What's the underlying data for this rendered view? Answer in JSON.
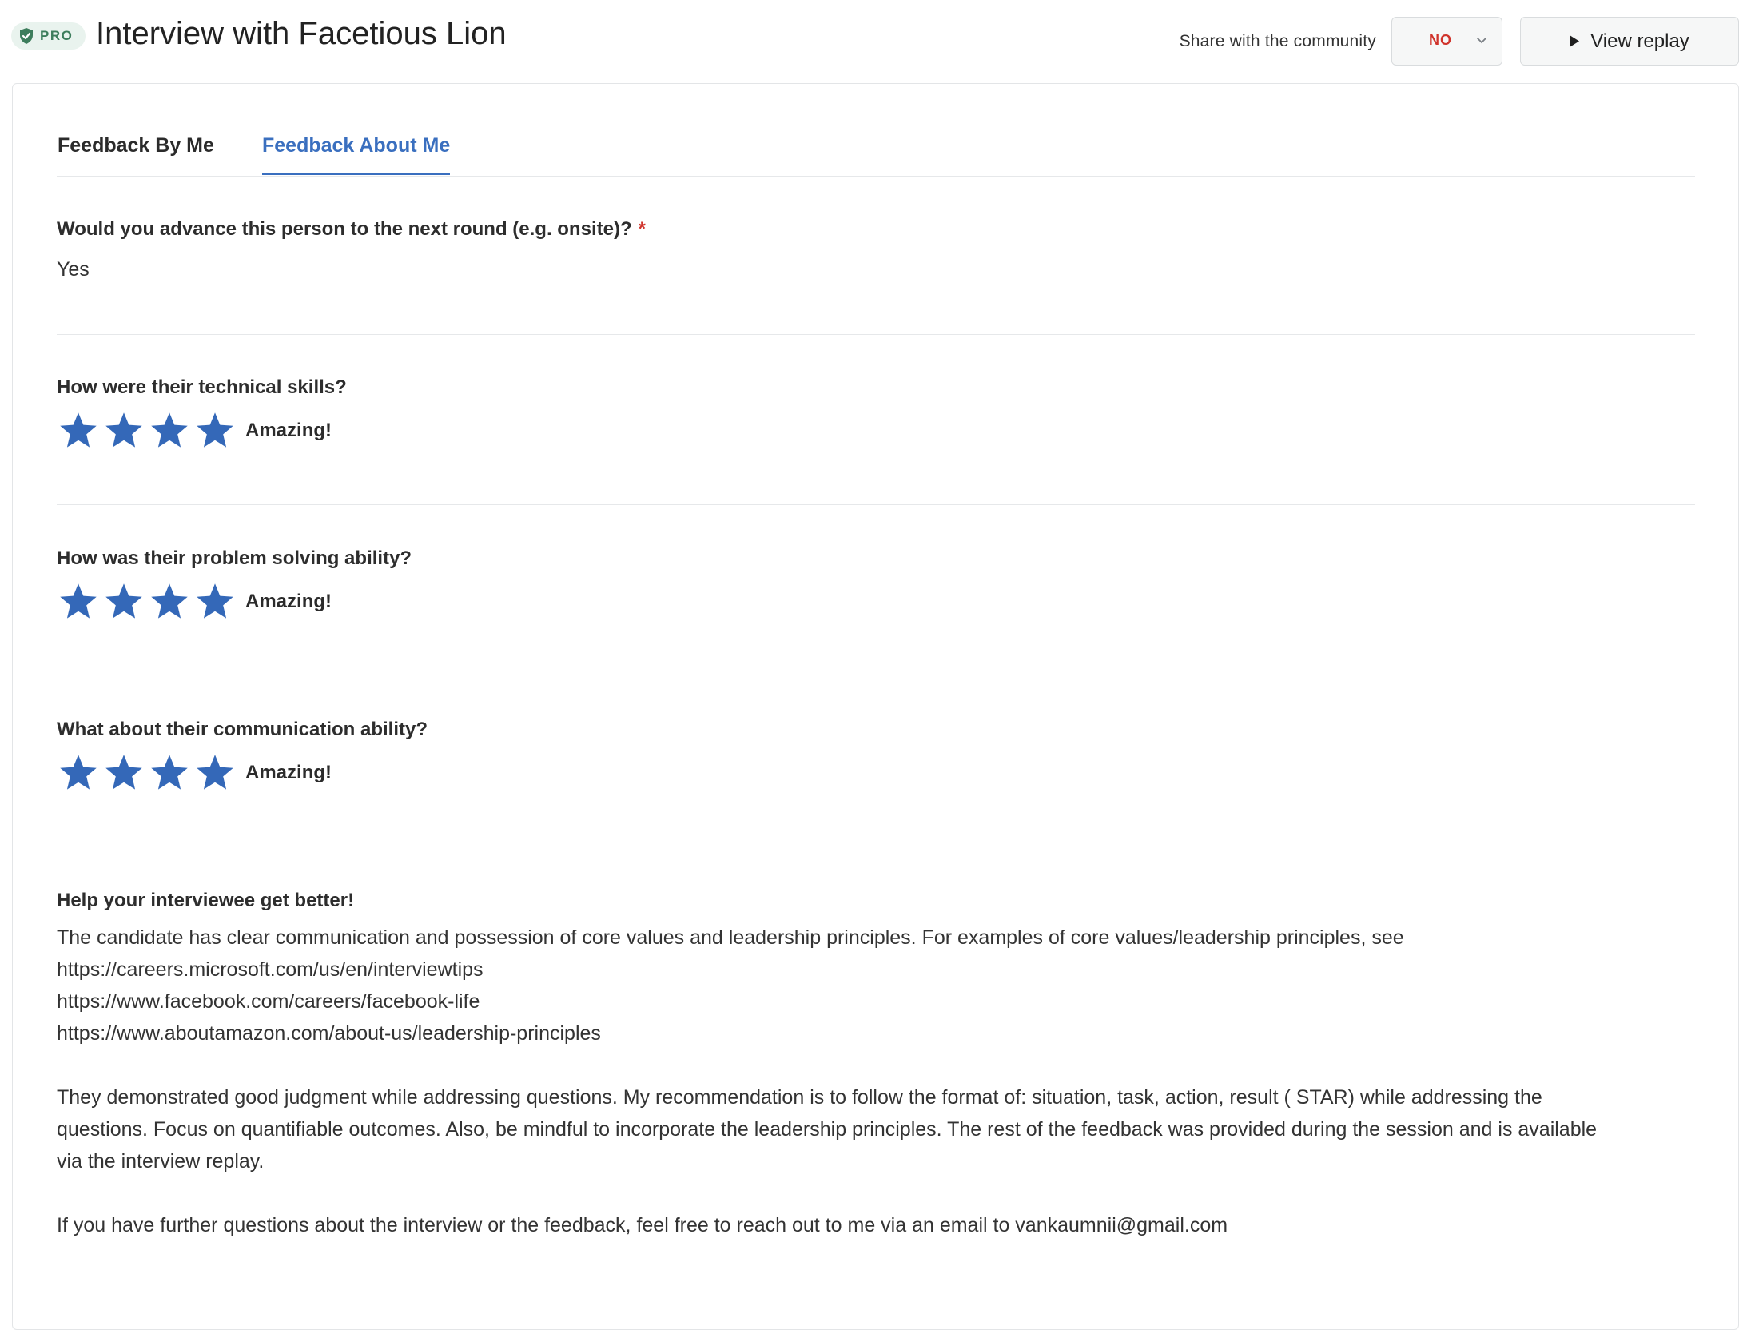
{
  "header": {
    "badge": "PRO",
    "title": "Interview with Facetious Lion",
    "share_label": "Share with the community",
    "share_value": "NO",
    "replay_label": "View replay"
  },
  "tabs": [
    {
      "label": "Feedback By Me",
      "active": false
    },
    {
      "label": "Feedback About Me",
      "active": true
    }
  ],
  "advance": {
    "question": "Would you advance this person to the next round (e.g. onsite)?",
    "required_mark": "*",
    "answer": "Yes"
  },
  "ratings": [
    {
      "question": "How were their technical skills?",
      "stars": 4,
      "label": "Amazing!"
    },
    {
      "question": "How was their problem solving ability?",
      "stars": 4,
      "label": "Amazing!"
    },
    {
      "question": "What about their communication ability?",
      "stars": 4,
      "label": "Amazing!"
    }
  ],
  "feedback": {
    "heading": "Help your interviewee get better!",
    "lines": [
      "The candidate has clear communication and possession of core values and leadership principles. For examples of core values/leadership principles, see",
      "https://careers.microsoft.com/us/en/interviewtips",
      "https://www.facebook.com/careers/facebook-life",
      "https://www.aboutamazon.com/about-us/leadership-principles"
    ],
    "paragraph2": [
      "They demonstrated good judgment while addressing questions. My recommendation is to follow the format of: situation, task, action, result ( STAR) while addressing the",
      "questions. Focus on quantifiable outcomes. Also, be mindful to incorporate the leadership principles. The rest of the feedback was provided during the session and is available",
      "via the interview replay."
    ],
    "paragraph3": "If you have further questions about the interview or the feedback, feel free to reach out to me via an email to vankaumnii@gmail.com"
  },
  "colors": {
    "accent": "#3a6fbf",
    "star": "#3468b8",
    "required": "#d0342c",
    "pro_green": "#3d7d5c"
  }
}
